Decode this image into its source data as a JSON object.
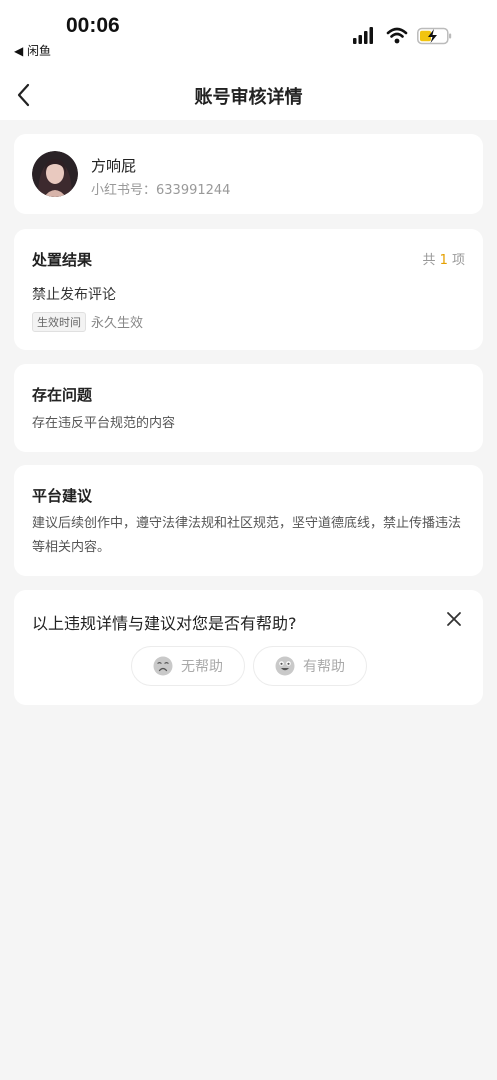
{
  "status_bar": {
    "time": "00:06",
    "back_app": "◀ 闲鱼"
  },
  "nav": {
    "title": "账号审核详情"
  },
  "user": {
    "name": "方响屁",
    "id_label": "小红书号：633991244"
  },
  "disposition": {
    "title": "处置结果",
    "count_prefix": "共 ",
    "count_num": "1",
    "count_suffix": " 项",
    "result": "禁止发布评论",
    "effective_tag": "生效时间",
    "effective_value": "永久生效"
  },
  "issue": {
    "title": "存在问题",
    "text": "存在违反平台规范的内容"
  },
  "advice": {
    "title": "平台建议",
    "text": "建议后续创作中，遵守法律法规和社区规范，坚守道德底线，禁止传播违法等相关内容。"
  },
  "feedback": {
    "question": "以上违规详情与建议对您是否有帮助?",
    "not_helpful": "无帮助",
    "helpful": "有帮助"
  }
}
